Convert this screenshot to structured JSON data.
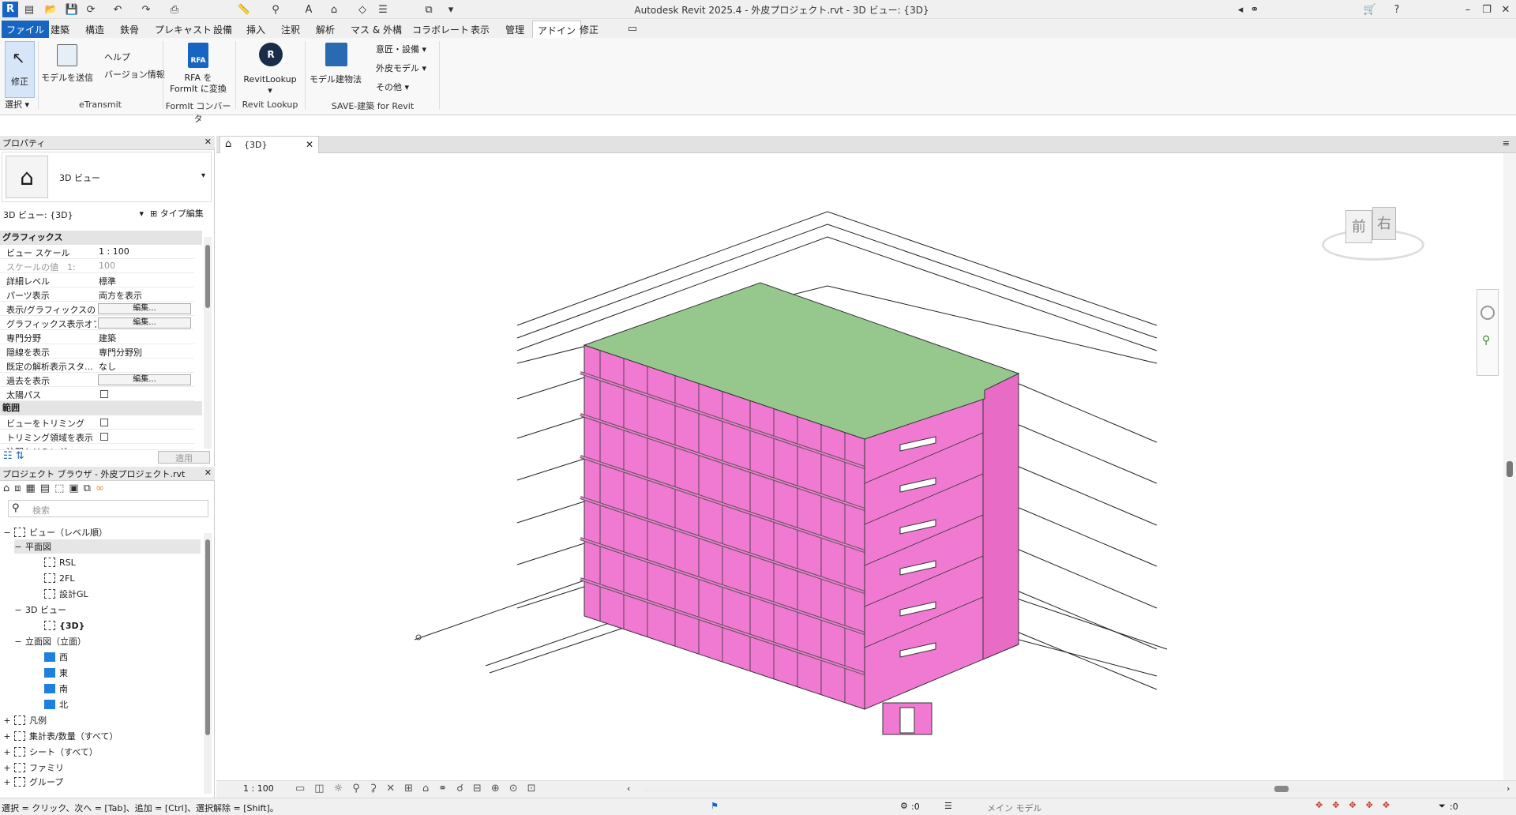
{
  "titlebar": {
    "app_title": "Autodesk Revit 2025.4 - 外皮プロジェクト.rvt - 3D ビュー: {3D}"
  },
  "ribbon_tabs": [
    {
      "label": "ファイル"
    },
    {
      "label": "建築"
    },
    {
      "label": "構造"
    },
    {
      "label": "鉄骨"
    },
    {
      "label": "プレキャスト"
    },
    {
      "label": "設備"
    },
    {
      "label": "挿入"
    },
    {
      "label": "注釈"
    },
    {
      "label": "解析"
    },
    {
      "label": "マス & 外構"
    },
    {
      "label": "コラボレート"
    },
    {
      "label": "表示"
    },
    {
      "label": "管理"
    },
    {
      "label": "アドイン"
    },
    {
      "label": "修正"
    }
  ],
  "ribbon": {
    "modify": "修正",
    "select_group": "選択",
    "send_model": "モデルを送信",
    "help": "ヘルプ",
    "version_info": "バージョン情報",
    "etransmit_group": "eTransmit",
    "rfa_convert_1": "RFA を",
    "rfa_convert_2": "FormIt に変換",
    "rfa_badge": "RFA",
    "formit_group": "FormIt コンバータ",
    "revitlookup": "RevitLookup",
    "revitlookup_group": "Revit Lookup",
    "model_building": "モデル建物法",
    "design_equipment": "意匠・設備",
    "envelope_model": "外皮モデル",
    "other": "その他",
    "save_group": "SAVE-建築 for Revit"
  },
  "properties": {
    "title": "プロパティ",
    "type_name": "3D ビュー",
    "selector_value": "3D ビュー: {3D}",
    "edit_type": "タイプ編集",
    "section_graphics": "グラフィックス",
    "section_extents": "範囲",
    "rows": [
      {
        "key": "ビュー スケール",
        "value": "1 : 100"
      },
      {
        "key": "スケールの値　1:",
        "value": "100"
      },
      {
        "key": "詳細レベル",
        "value": "標準"
      },
      {
        "key": "パーツ表示",
        "value": "両方を表示"
      },
      {
        "key": "表示/グラフィックスの...",
        "value": "編集..."
      },
      {
        "key": "グラフィックス表示オプ...",
        "value": "編集..."
      },
      {
        "key": "専門分野",
        "value": "建築"
      },
      {
        "key": "隠線を表示",
        "value": "専門分野別"
      },
      {
        "key": "既定の解析表示スタ...",
        "value": "なし"
      },
      {
        "key": "過去を表示",
        "value": "編集..."
      },
      {
        "key": "太陽パス",
        "value": ""
      }
    ],
    "extent_rows": [
      {
        "key": "ビューをトリミング"
      },
      {
        "key": "トリミング領域を表示"
      },
      {
        "key": "注釈トリミング"
      }
    ],
    "apply": "適用"
  },
  "browser": {
    "title": "プロジェクト ブラウザ - 外皮プロジェクト.rvt",
    "search_placeholder": "検索",
    "items": [
      {
        "label": "ビュー（レベル順）",
        "expander": "−"
      },
      {
        "label": "平面図",
        "expander": "−"
      },
      {
        "label": "RSL"
      },
      {
        "label": "2FL"
      },
      {
        "label": "設計GL"
      },
      {
        "label": "3D ビュー",
        "expander": "−"
      },
      {
        "label": "{3D}"
      },
      {
        "label": "立面図（立面）",
        "expander": "−"
      },
      {
        "label": "西"
      },
      {
        "label": "東"
      },
      {
        "label": "南"
      },
      {
        "label": "北"
      },
      {
        "label": "凡例",
        "expander": "+"
      },
      {
        "label": "集計表/数量（すべて）",
        "expander": "+"
      },
      {
        "label": "シート（すべて）",
        "expander": "+"
      },
      {
        "label": "ファミリ",
        "expander": "+"
      },
      {
        "label": "グループ",
        "expander": "+"
      }
    ]
  },
  "view": {
    "tab_label": "{3D}",
    "scale": "1 : 100",
    "viewcube_front": "前",
    "viewcube_right": "右"
  },
  "status": {
    "hint": "選択 = クリック、次へ = [Tab]、追加 = [Ctrl]、選択解除 = [Shift]。",
    "workset_count": ":0",
    "main_model": "メイン モデル",
    "filter_count": ":0"
  },
  "colors": {
    "facade": "#f07ad2",
    "roof": "#96c88e",
    "accent": "#1765c1"
  }
}
